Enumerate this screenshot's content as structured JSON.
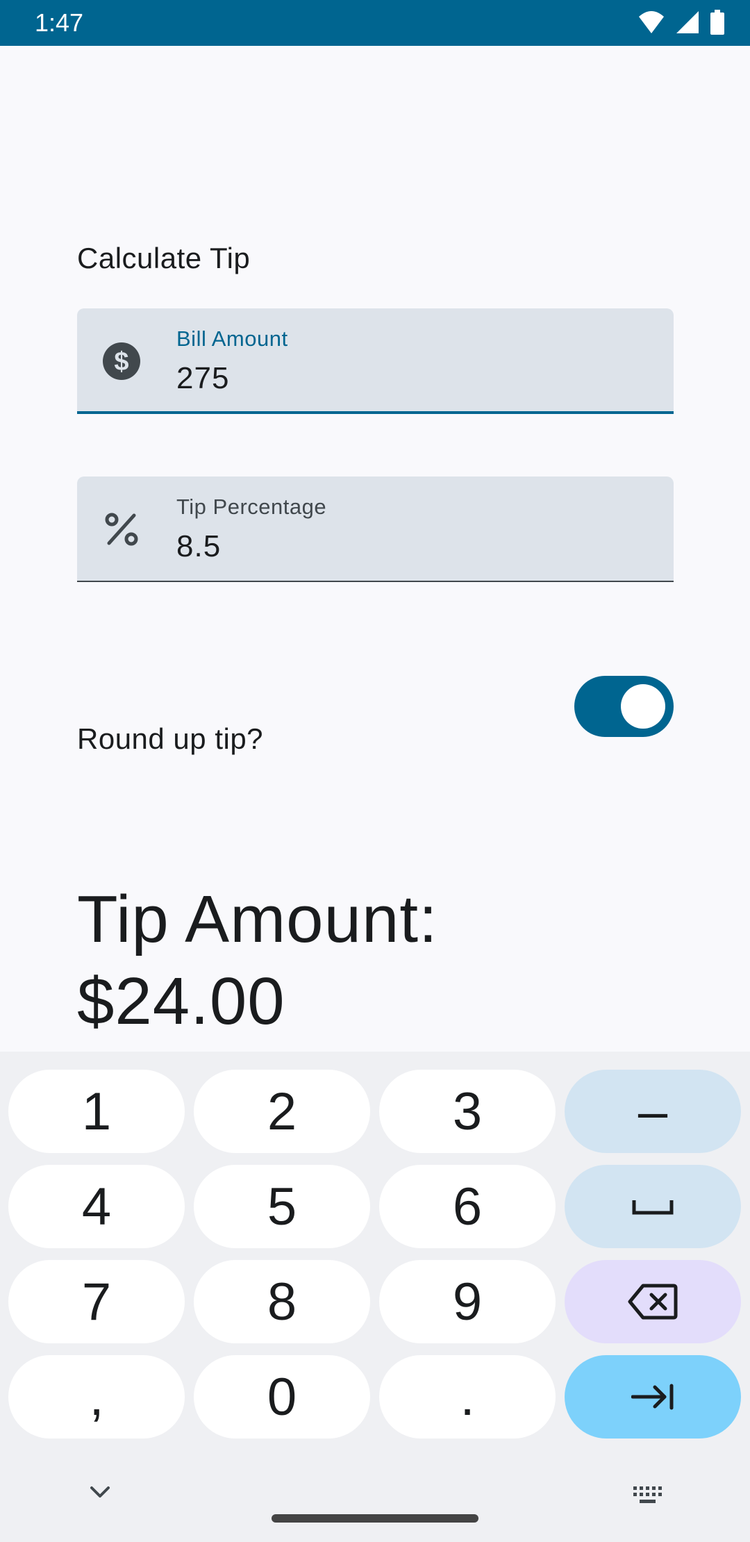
{
  "status_bar": {
    "time": "1:47",
    "icons": [
      "wifi-icon",
      "signal-icon",
      "battery-icon"
    ]
  },
  "app": {
    "title": "Calculate Tip",
    "bill_field": {
      "label": "Bill Amount",
      "value": "275",
      "icon": "dollar-icon"
    },
    "tip_field": {
      "label": "Tip Percentage",
      "value": "8.5",
      "icon": "percent-icon"
    },
    "round_up": {
      "label": "Round up tip?",
      "checked": true
    },
    "result": {
      "line1": "Tip Amount:",
      "line2": "$24.00"
    }
  },
  "keyboard": {
    "rows": [
      [
        "1",
        "2",
        "3",
        "–"
      ],
      [
        "4",
        "5",
        "6",
        "space-icon"
      ],
      [
        "7",
        "8",
        "9",
        "backspace-icon"
      ],
      [
        ",",
        "0",
        ".",
        "tab-enter-icon"
      ]
    ],
    "bottom_icons": [
      "chevron-down-icon",
      "keyboard-icon"
    ]
  },
  "colors": {
    "primary": "#006590",
    "field_bg": "#dde3ea",
    "enter_key": "#7dd1fb",
    "fn_key": "#d2e4f2",
    "delete_key": "#e3ddfb"
  }
}
